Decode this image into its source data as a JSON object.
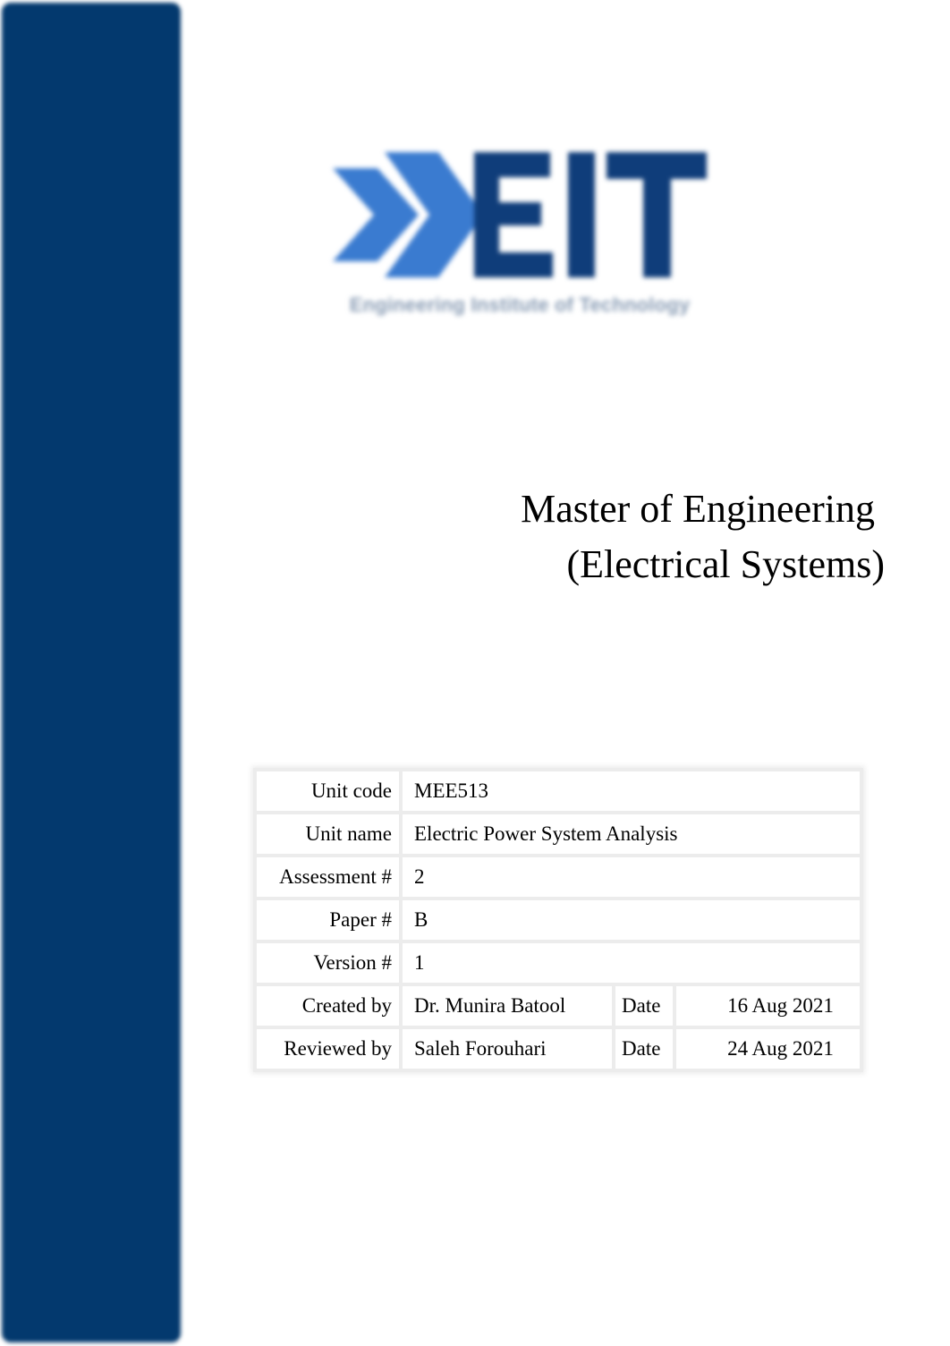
{
  "colors": {
    "sidebar": "#03396e",
    "logo_chevron": "#3a7bd0",
    "logo_letters": "#0f3d7a",
    "logo_tagline": "#8a9db5",
    "table_border": "#ececec"
  },
  "logo": {
    "acronym": "EIT",
    "tagline": "Engineering Institute of Technology",
    "icon": "double-chevron-icon"
  },
  "title": {
    "line1": "Master of Engineering",
    "line2": "(Electrical Systems)"
  },
  "info": {
    "unit_code": {
      "label": "Unit code",
      "value": "MEE513"
    },
    "unit_name": {
      "label": "Unit name",
      "value": "Electric Power System Analysis"
    },
    "assessment": {
      "label": "Assessment #",
      "value": "2"
    },
    "paper": {
      "label": "Paper #",
      "value": "B"
    },
    "version": {
      "label": "Version #",
      "value": "1"
    },
    "created": {
      "label": "Created by",
      "value": "Dr. Munira Batool",
      "date_label": "Date",
      "date": "16 Aug 2021"
    },
    "reviewed": {
      "label": "Reviewed by",
      "value": "Saleh Forouhari",
      "date_label": "Date",
      "date": "24 Aug 2021"
    }
  }
}
